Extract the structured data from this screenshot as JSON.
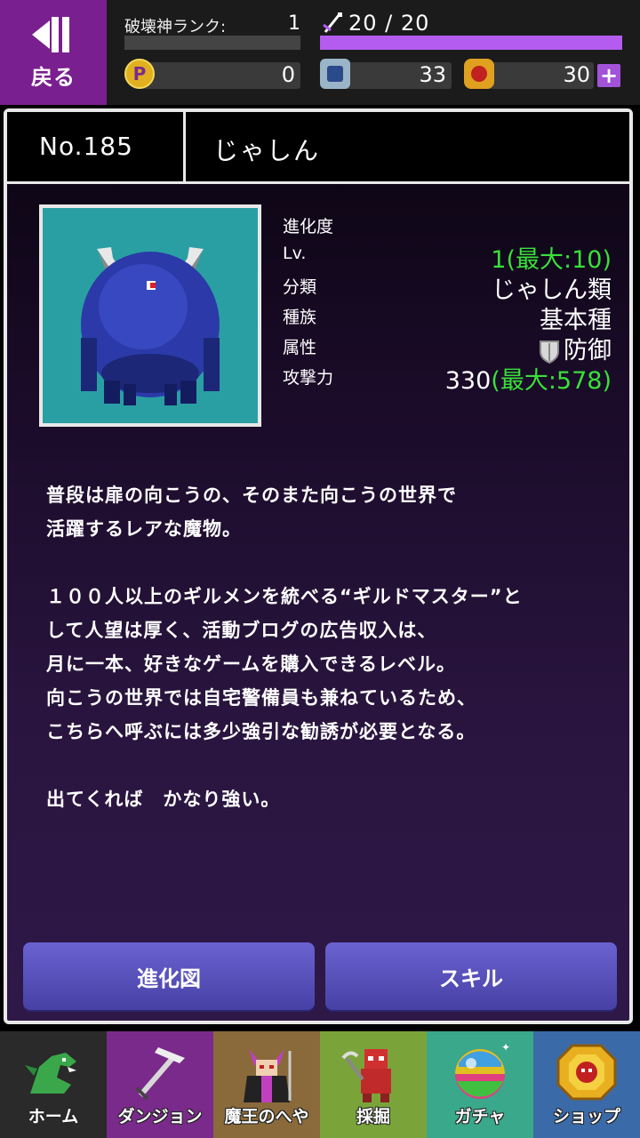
{
  "header": {
    "back_label": "戻る",
    "rank_label": "破壊神ランク:",
    "rank_value": "1",
    "rank_progress": 0,
    "stamina_text": "20 / 20",
    "stamina_progress": 1.0,
    "currencies": [
      {
        "icon": "p-coin-icon",
        "value": "0"
      },
      {
        "icon": "crystal-icon",
        "value": "33"
      },
      {
        "icon": "gem-icon",
        "value": "30"
      }
    ],
    "plus_label": "+"
  },
  "monster": {
    "number": "No.185",
    "name": "じゃしん",
    "stats": [
      {
        "label": "進化度",
        "value": "",
        "extra": ""
      },
      {
        "label": "Lv.",
        "value": "1",
        "extra": "(最大:10)"
      },
      {
        "label": "分類",
        "value": "じゃしん類",
        "extra": ""
      },
      {
        "label": "種族",
        "value": "基本種",
        "extra": ""
      },
      {
        "label": "属性",
        "value": "防御",
        "extra": ""
      },
      {
        "label": "攻撃力",
        "value": "330",
        "extra": "(最大:578)"
      }
    ],
    "description": "普段は扉の向こうの、そのまた向こうの世界で\n活躍するレアな魔物。\n\n１００人以上のギルメンを統べる“ギルドマスター”と\nして人望は厚く、活動ブログの広告収入は、\n月に一本、好きなゲームを購入できるレベル。\n向こうの世界では自宅警備員も兼ねているため、\nこちらへ呼ぶには多少強引な勧誘が必要となる。\n\n出てくれば　かなり強い。"
  },
  "buttons": {
    "evolution": "進化図",
    "skill": "スキル"
  },
  "nav": [
    {
      "label": "ホーム",
      "icon": "dragon-icon",
      "bg": "#2a2a2a"
    },
    {
      "label": "ダンジョン",
      "icon": "pickaxe-icon",
      "bg": "#7a2a8a"
    },
    {
      "label": "魔王のへや",
      "icon": "demon-king-icon",
      "bg": "#8a6a3a"
    },
    {
      "label": "採掘",
      "icon": "digger-icon",
      "bg": "#7aa43a"
    },
    {
      "label": "ガチャ",
      "icon": "gacha-ball-icon",
      "bg": "#3aa88a"
    },
    {
      "label": "ショップ",
      "icon": "shop-gem-icon",
      "bg": "#3a6aa8"
    }
  ]
}
